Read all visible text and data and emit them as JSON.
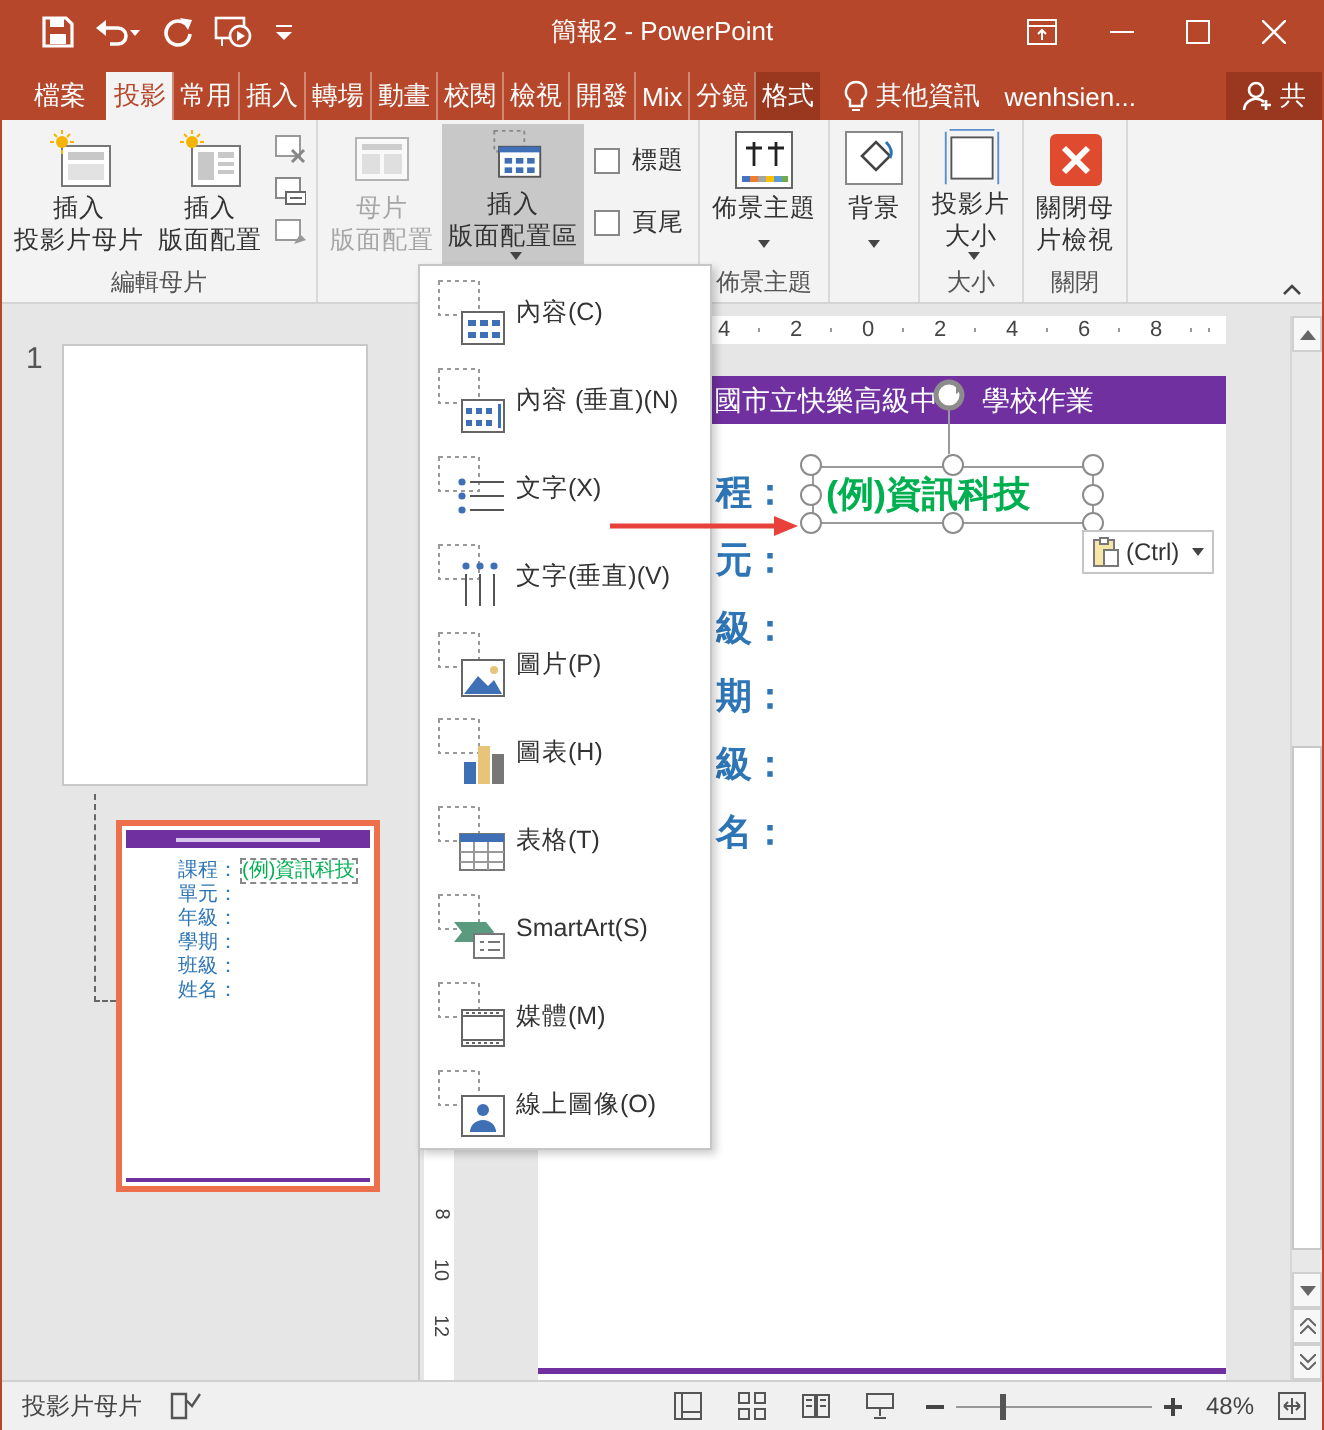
{
  "window": {
    "title": "簡報2 - PowerPoint"
  },
  "tabs": [
    {
      "label": "檔案",
      "kind": "file",
      "selected": false
    },
    {
      "label": "投影",
      "kind": "tab",
      "selected": true
    },
    {
      "label": "常用",
      "kind": "tab",
      "selected": false
    },
    {
      "label": "插入",
      "kind": "tab",
      "selected": false
    },
    {
      "label": "轉場",
      "kind": "tab",
      "selected": false
    },
    {
      "label": "動畫",
      "kind": "tab",
      "selected": false
    },
    {
      "label": "校閱",
      "kind": "tab",
      "selected": false
    },
    {
      "label": "檢視",
      "kind": "tab",
      "selected": false
    },
    {
      "label": "開發",
      "kind": "tab",
      "selected": false
    },
    {
      "label": "Mix",
      "kind": "tab",
      "selected": false
    },
    {
      "label": "分鏡",
      "kind": "tab",
      "selected": false
    },
    {
      "label": "格式",
      "kind": "contextual",
      "selected": false
    }
  ],
  "tell_me": {
    "label": "其他資訊"
  },
  "account": {
    "user": "wenhsien...",
    "share": "共"
  },
  "ribbon": {
    "groups": [
      {
        "label": "編輯母片",
        "buttons": [
          {
            "kind": "large",
            "label": [
              "插入",
              "投影片母片"
            ],
            "disabled": false,
            "pressed": false
          },
          {
            "kind": "large",
            "label": [
              "插入",
              "版面配置"
            ],
            "disabled": false,
            "pressed": false
          },
          {
            "kind": "small"
          },
          {
            "kind": "small"
          },
          {
            "kind": "small"
          }
        ]
      },
      {
        "buttons": [
          {
            "kind": "large",
            "label": [
              "母片",
              "版面配置"
            ],
            "disabled": true,
            "pressed": false
          },
          {
            "kind": "dropdown",
            "label": [
              "插入",
              "版面配置區"
            ],
            "disabled": false,
            "pressed": true
          },
          {
            "kind": "checkbox",
            "label": "標題",
            "checked": false
          },
          {
            "kind": "checkbox",
            "label": "頁尾",
            "checked": false
          }
        ]
      },
      {
        "label": "佈景主題",
        "buttons": [
          {
            "kind": "gallery",
            "label": [
              "佈景主題"
            ],
            "disabled": false,
            "pressed": false
          }
        ]
      },
      {
        "buttons": [
          {
            "kind": "gallery",
            "label": [
              "背景"
            ],
            "disabled": false,
            "pressed": false
          }
        ]
      },
      {
        "label": "大小",
        "buttons": [
          {
            "kind": "dropdown",
            "label": [
              "投影片",
              "大小"
            ],
            "disabled": false,
            "pressed": false
          }
        ]
      },
      {
        "label": "關閉",
        "buttons": [
          {
            "kind": "large",
            "label": [
              "關閉母",
              "片檢視"
            ],
            "disabled": false,
            "pressed": false
          }
        ]
      }
    ]
  },
  "layout_menu": {
    "items": [
      {
        "label": "內容(C)"
      },
      {
        "label": "內容 (垂直)(N)"
      },
      {
        "label": "文字(X)"
      },
      {
        "label": "文字(垂直)(V)"
      },
      {
        "label": "圖片(P)"
      },
      {
        "label": "圖表(H)"
      },
      {
        "label": "表格(T)"
      },
      {
        "label": "SmartArt(S)"
      },
      {
        "label": "媒體(M)"
      },
      {
        "label": "線上圖像(O)"
      }
    ]
  },
  "thumbnails": [
    {
      "kind": "master",
      "number": "1",
      "selected": false
    },
    {
      "kind": "layout",
      "selected": true,
      "labels": [
        "課程：",
        "單元：",
        "年級：",
        "學期：",
        "班級：",
        "姓名："
      ],
      "sample": "(例)資訊科技"
    }
  ],
  "ruler": {
    "marks": [
      "4",
      "2",
      "0",
      "2",
      "4",
      "6",
      "8"
    ]
  },
  "vertical_ruler": {
    "marks": [
      "8",
      "10",
      "12"
    ]
  },
  "slide": {
    "header": [
      "國市立快樂高級中",
      "學校作業"
    ],
    "labels": [
      "程：",
      "元：",
      "級：",
      "期：",
      "級：",
      "名："
    ],
    "textbox": {
      "text": "(例)資訊科技",
      "selected": true
    },
    "paste_options": {
      "label": "(Ctrl)"
    }
  },
  "status_bar": {
    "mode": "投影片母片",
    "zoom": "48%",
    "zoom_slider": {
      "level": 0.23
    }
  }
}
